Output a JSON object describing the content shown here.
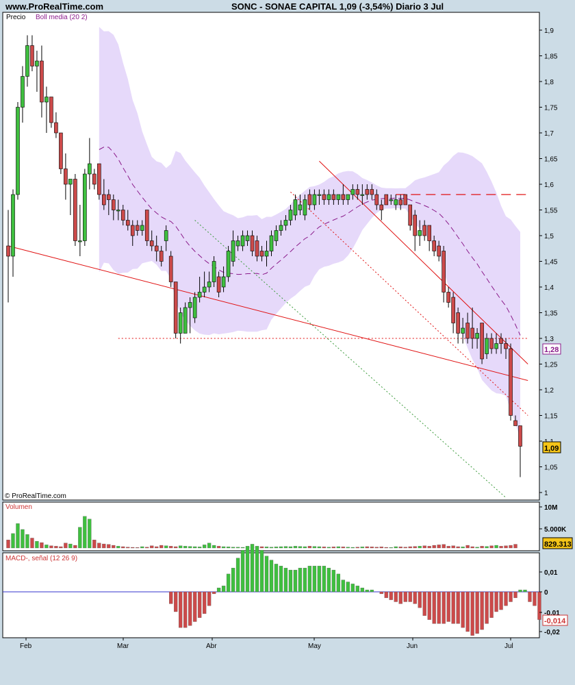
{
  "header": {
    "site": "www.ProRealTime.com",
    "title": "SONC - SONAE CAPITAL     1,09 (-3,54%)   Diario  3 Jul"
  },
  "price_panel": {
    "label_price": "Precio",
    "label_boll": "Boll media (20 2)",
    "copyright": "© ProRealTime.com",
    "y_ticks": [
      "1,9",
      "1,85",
      "1,8",
      "1,75",
      "1,7",
      "1,65",
      "1,6",
      "1,55",
      "1,5",
      "1,45",
      "1,4",
      "1,35",
      "1,3",
      "1,25",
      "1,2",
      "1,15",
      "1,1",
      "1,05",
      "1"
    ],
    "badge_boll": "1,28",
    "badge_price": "1,09"
  },
  "volume_panel": {
    "label": "Volumen",
    "y_ticks": [
      "10M",
      "5.000K"
    ],
    "badge": "829.313"
  },
  "macd_panel": {
    "label": "MACD-, señal (12 26 9)",
    "y_ticks": [
      "0,01",
      "0",
      "-0,01",
      "-0,02"
    ],
    "badge": "-0,014"
  },
  "x_ticks": [
    "Feb",
    "Mar",
    "Abr",
    "May",
    "Jun",
    "Jul"
  ],
  "colors": {
    "up": "#3fbf3f",
    "down": "#cc4a4a",
    "band": "#e6d9fa",
    "boll_mid": "#8a1a8a",
    "trend": "#e01010",
    "support_green": "#3a9a3a"
  },
  "chart_data": {
    "type": "candlestick",
    "candles": [
      {
        "o": 1.48,
        "h": 1.55,
        "l": 1.37,
        "c": 1.46
      },
      {
        "o": 1.46,
        "h": 1.59,
        "l": 1.42,
        "c": 1.58
      },
      {
        "o": 1.58,
        "h": 1.76,
        "l": 1.57,
        "c": 1.75
      },
      {
        "o": 1.75,
        "h": 1.83,
        "l": 1.72,
        "c": 1.81
      },
      {
        "o": 1.81,
        "h": 1.89,
        "l": 1.79,
        "c": 1.87
      },
      {
        "o": 1.87,
        "h": 1.89,
        "l": 1.82,
        "c": 1.83
      },
      {
        "o": 1.83,
        "h": 1.86,
        "l": 1.78,
        "c": 1.84
      },
      {
        "o": 1.84,
        "h": 1.87,
        "l": 1.73,
        "c": 1.76
      },
      {
        "o": 1.76,
        "h": 1.79,
        "l": 1.7,
        "c": 1.77
      },
      {
        "o": 1.77,
        "h": 1.77,
        "l": 1.71,
        "c": 1.72
      },
      {
        "o": 1.72,
        "h": 1.74,
        "l": 1.69,
        "c": 1.7
      },
      {
        "o": 1.7,
        "h": 1.7,
        "l": 1.62,
        "c": 1.63
      },
      {
        "o": 1.63,
        "h": 1.66,
        "l": 1.57,
        "c": 1.6
      },
      {
        "o": 1.6,
        "h": 1.61,
        "l": 1.54,
        "c": 1.61
      },
      {
        "o": 1.61,
        "h": 1.62,
        "l": 1.48,
        "c": 1.49
      },
      {
        "o": 1.49,
        "h": 1.56,
        "l": 1.46,
        "c": 1.49
      },
      {
        "o": 1.49,
        "h": 1.63,
        "l": 1.48,
        "c": 1.62
      },
      {
        "o": 1.62,
        "h": 1.69,
        "l": 1.59,
        "c": 1.64
      },
      {
        "o": 1.62,
        "h": 1.63,
        "l": 1.59,
        "c": 1.6
      },
      {
        "o": 1.64,
        "h": 1.64,
        "l": 1.57,
        "c": 1.58
      },
      {
        "o": 1.58,
        "h": 1.61,
        "l": 1.55,
        "c": 1.56
      },
      {
        "o": 1.58,
        "h": 1.59,
        "l": 1.54,
        "c": 1.57
      },
      {
        "o": 1.57,
        "h": 1.58,
        "l": 1.53,
        "c": 1.55
      },
      {
        "o": 1.55,
        "h": 1.57,
        "l": 1.53,
        "c": 1.55
      },
      {
        "o": 1.55,
        "h": 1.56,
        "l": 1.52,
        "c": 1.53
      },
      {
        "o": 1.53,
        "h": 1.55,
        "l": 1.51,
        "c": 1.52
      },
      {
        "o": 1.52,
        "h": 1.53,
        "l": 1.48,
        "c": 1.5
      },
      {
        "o": 1.52,
        "h": 1.53,
        "l": 1.5,
        "c": 1.51
      },
      {
        "o": 1.51,
        "h": 1.53,
        "l": 1.5,
        "c": 1.52
      },
      {
        "o": 1.55,
        "h": 1.55,
        "l": 1.48,
        "c": 1.49
      },
      {
        "o": 1.49,
        "h": 1.51,
        "l": 1.47,
        "c": 1.48
      },
      {
        "o": 1.48,
        "h": 1.5,
        "l": 1.45,
        "c": 1.47
      },
      {
        "o": 1.47,
        "h": 1.48,
        "l": 1.44,
        "c": 1.45
      },
      {
        "o": 1.49,
        "h": 1.52,
        "l": 1.47,
        "c": 1.51
      },
      {
        "o": 1.46,
        "h": 1.47,
        "l": 1.4,
        "c": 1.41
      },
      {
        "o": 1.41,
        "h": 1.41,
        "l": 1.3,
        "c": 1.31
      },
      {
        "o": 1.31,
        "h": 1.36,
        "l": 1.29,
        "c": 1.35
      },
      {
        "o": 1.31,
        "h": 1.37,
        "l": 1.31,
        "c": 1.36
      },
      {
        "o": 1.36,
        "h": 1.38,
        "l": 1.31,
        "c": 1.37
      },
      {
        "o": 1.34,
        "h": 1.39,
        "l": 1.33,
        "c": 1.38
      },
      {
        "o": 1.38,
        "h": 1.42,
        "l": 1.37,
        "c": 1.39
      },
      {
        "o": 1.39,
        "h": 1.43,
        "l": 1.38,
        "c": 1.4
      },
      {
        "o": 1.4,
        "h": 1.43,
        "l": 1.39,
        "c": 1.41
      },
      {
        "o": 1.41,
        "h": 1.46,
        "l": 1.4,
        "c": 1.45
      },
      {
        "o": 1.42,
        "h": 1.43,
        "l": 1.38,
        "c": 1.39
      },
      {
        "o": 1.4,
        "h": 1.44,
        "l": 1.39,
        "c": 1.42
      },
      {
        "o": 1.42,
        "h": 1.48,
        "l": 1.41,
        "c": 1.47
      },
      {
        "o": 1.45,
        "h": 1.51,
        "l": 1.44,
        "c": 1.49
      },
      {
        "o": 1.48,
        "h": 1.5,
        "l": 1.47,
        "c": 1.49
      },
      {
        "o": 1.48,
        "h": 1.51,
        "l": 1.47,
        "c": 1.5
      },
      {
        "o": 1.49,
        "h": 1.51,
        "l": 1.48,
        "c": 1.5
      },
      {
        "o": 1.5,
        "h": 1.51,
        "l": 1.46,
        "c": 1.47
      },
      {
        "o": 1.49,
        "h": 1.5,
        "l": 1.45,
        "c": 1.46
      },
      {
        "o": 1.47,
        "h": 1.48,
        "l": 1.45,
        "c": 1.46
      },
      {
        "o": 1.46,
        "h": 1.49,
        "l": 1.44,
        "c": 1.47
      },
      {
        "o": 1.47,
        "h": 1.51,
        "l": 1.46,
        "c": 1.5
      },
      {
        "o": 1.49,
        "h": 1.52,
        "l": 1.48,
        "c": 1.51
      },
      {
        "o": 1.51,
        "h": 1.53,
        "l": 1.5,
        "c": 1.52
      },
      {
        "o": 1.52,
        "h": 1.54,
        "l": 1.51,
        "c": 1.53
      },
      {
        "o": 1.53,
        "h": 1.56,
        "l": 1.52,
        "c": 1.55
      },
      {
        "o": 1.54,
        "h": 1.58,
        "l": 1.53,
        "c": 1.57
      },
      {
        "o": 1.55,
        "h": 1.58,
        "l": 1.54,
        "c": 1.56
      },
      {
        "o": 1.54,
        "h": 1.58,
        "l": 1.53,
        "c": 1.57
      },
      {
        "o": 1.58,
        "h": 1.59,
        "l": 1.55,
        "c": 1.56
      },
      {
        "o": 1.56,
        "h": 1.59,
        "l": 1.55,
        "c": 1.58
      },
      {
        "o": 1.58,
        "h": 1.59,
        "l": 1.56,
        "c": 1.58
      },
      {
        "o": 1.58,
        "h": 1.59,
        "l": 1.56,
        "c": 1.57
      },
      {
        "o": 1.57,
        "h": 1.59,
        "l": 1.56,
        "c": 1.58
      },
      {
        "o": 1.58,
        "h": 1.59,
        "l": 1.56,
        "c": 1.57
      },
      {
        "o": 1.57,
        "h": 1.58,
        "l": 1.56,
        "c": 1.58
      },
      {
        "o": 1.58,
        "h": 1.6,
        "l": 1.56,
        "c": 1.57
      },
      {
        "o": 1.57,
        "h": 1.58,
        "l": 1.56,
        "c": 1.58
      },
      {
        "o": 1.58,
        "h": 1.6,
        "l": 1.57,
        "c": 1.59
      },
      {
        "o": 1.59,
        "h": 1.6,
        "l": 1.57,
        "c": 1.58
      },
      {
        "o": 1.58,
        "h": 1.6,
        "l": 1.56,
        "c": 1.58
      },
      {
        "o": 1.59,
        "h": 1.6,
        "l": 1.57,
        "c": 1.58
      },
      {
        "o": 1.59,
        "h": 1.6,
        "l": 1.57,
        "c": 1.58
      },
      {
        "o": 1.58,
        "h": 1.59,
        "l": 1.55,
        "c": 1.56
      },
      {
        "o": 1.56,
        "h": 1.57,
        "l": 1.53,
        "c": 1.55
      },
      {
        "o": 1.58,
        "h": 1.58,
        "l": 1.56,
        "c": 1.56
      },
      {
        "o": 1.57,
        "h": 1.58,
        "l": 1.56,
        "c": 1.57
      },
      {
        "o": 1.56,
        "h": 1.58,
        "l": 1.55,
        "c": 1.57
      },
      {
        "o": 1.57,
        "h": 1.58,
        "l": 1.55,
        "c": 1.56
      },
      {
        "o": 1.58,
        "h": 1.58,
        "l": 1.56,
        "c": 1.56
      },
      {
        "o": 1.56,
        "h": 1.56,
        "l": 1.51,
        "c": 1.52
      },
      {
        "o": 1.54,
        "h": 1.55,
        "l": 1.47,
        "c": 1.5
      },
      {
        "o": 1.5,
        "h": 1.53,
        "l": 1.48,
        "c": 1.51
      },
      {
        "o": 1.52,
        "h": 1.53,
        "l": 1.49,
        "c": 1.5
      },
      {
        "o": 1.52,
        "h": 1.52,
        "l": 1.47,
        "c": 1.49
      },
      {
        "o": 1.49,
        "h": 1.5,
        "l": 1.46,
        "c": 1.47
      },
      {
        "o": 1.48,
        "h": 1.49,
        "l": 1.45,
        "c": 1.46
      },
      {
        "o": 1.47,
        "h": 1.48,
        "l": 1.37,
        "c": 1.39
      },
      {
        "o": 1.39,
        "h": 1.4,
        "l": 1.36,
        "c": 1.37
      },
      {
        "o": 1.38,
        "h": 1.39,
        "l": 1.31,
        "c": 1.33
      },
      {
        "o": 1.35,
        "h": 1.36,
        "l": 1.29,
        "c": 1.31
      },
      {
        "o": 1.31,
        "h": 1.34,
        "l": 1.29,
        "c": 1.32
      },
      {
        "o": 1.33,
        "h": 1.35,
        "l": 1.29,
        "c": 1.3
      },
      {
        "o": 1.32,
        "h": 1.36,
        "l": 1.28,
        "c": 1.3
      },
      {
        "o": 1.3,
        "h": 1.32,
        "l": 1.28,
        "c": 1.31
      },
      {
        "o": 1.33,
        "h": 1.33,
        "l": 1.25,
        "c": 1.26
      },
      {
        "o": 1.27,
        "h": 1.31,
        "l": 1.26,
        "c": 1.3
      },
      {
        "o": 1.3,
        "h": 1.31,
        "l": 1.27,
        "c": 1.28
      },
      {
        "o": 1.28,
        "h": 1.31,
        "l": 1.27,
        "c": 1.29
      },
      {
        "o": 1.3,
        "h": 1.31,
        "l": 1.27,
        "c": 1.29
      },
      {
        "o": 1.29,
        "h": 1.3,
        "l": 1.26,
        "c": 1.28
      },
      {
        "o": 1.28,
        "h": 1.29,
        "l": 1.14,
        "c": 1.15
      },
      {
        "o": 1.14,
        "h": 1.15,
        "l": 1.13,
        "c": 1.13
      },
      {
        "o": 1.13,
        "h": 1.13,
        "l": 1.03,
        "c": 1.09
      }
    ],
    "volume_k": [
      1800,
      3200,
      5400,
      4100,
      3000,
      2200,
      1500,
      1200,
      700,
      500,
      400,
      300,
      1100,
      900,
      600,
      4600,
      7000,
      6400,
      1800,
      1100,
      900,
      800,
      600,
      400,
      300,
      200,
      150,
      120,
      300,
      200,
      500,
      300,
      600,
      500,
      400,
      300,
      500,
      400,
      350,
      300,
      250,
      700,
      1100,
      600,
      400,
      300,
      250,
      200,
      180,
      150,
      150,
      200,
      180,
      300,
      250,
      200,
      250,
      300,
      350,
      300,
      400,
      350,
      300,
      400,
      350,
      300,
      250,
      200,
      250,
      300,
      250,
      200,
      150,
      200,
      250,
      300,
      250,
      200,
      250,
      150,
      120,
      300,
      250,
      200,
      300,
      350,
      400,
      500,
      400,
      600,
      700,
      800,
      400,
      500,
      300,
      250,
      600,
      300,
      200,
      400,
      350,
      500,
      600,
      400,
      500,
      600,
      829
    ],
    "macd_x1000": [
      0,
      0,
      0,
      0,
      0,
      0,
      0,
      0,
      0,
      0,
      0,
      0,
      0,
      0,
      0,
      0,
      0,
      0,
      0,
      0,
      0,
      0,
      0,
      0,
      0,
      0,
      0,
      0,
      0,
      0,
      0,
      0,
      0,
      0,
      -6,
      -10,
      -18,
      -18,
      -17,
      -15,
      -13,
      -11,
      -7,
      -1,
      2,
      3,
      9,
      12,
      17,
      21,
      23,
      24,
      23,
      21,
      18,
      16,
      14,
      13,
      12,
      11,
      11,
      12,
      12,
      13,
      13,
      13,
      13,
      12,
      11,
      9,
      6,
      5,
      4,
      3,
      2,
      1,
      1,
      0,
      -1,
      -3,
      -4,
      -5,
      -6,
      -5,
      -5,
      -6,
      -8,
      -12,
      -14,
      -16,
      -16,
      -16,
      -15,
      -16,
      -16,
      -18,
      -20,
      -22,
      -21,
      -19,
      -16,
      -13,
      -10,
      -9,
      -7,
      -5,
      -3,
      1,
      1,
      -5,
      -7,
      -14
    ]
  }
}
